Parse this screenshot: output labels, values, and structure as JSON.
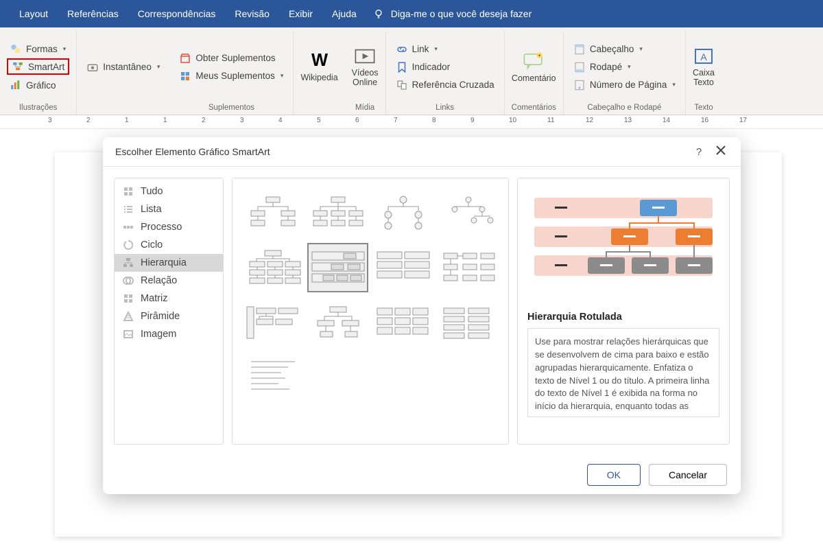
{
  "tabs": {
    "layout": "Layout",
    "references": "Referências",
    "mailings": "Correspondências",
    "review": "Revisão",
    "view": "Exibir",
    "help": "Ajuda",
    "tellme": "Diga-me o que você deseja fazer"
  },
  "ribbon": {
    "ilustracoes": {
      "label": "Ilustrações",
      "formas": "Formas",
      "smartart": "SmartArt",
      "grafico": "Gráfico"
    },
    "instantaneo": "Instantâneo",
    "suplementos": {
      "label": "Suplementos",
      "obter": "Obter Suplementos",
      "meus": "Meus Suplementos"
    },
    "wikipedia": "Wikipedia",
    "midia": {
      "label": "Mídia",
      "videos": "Vídeos\nOnline"
    },
    "links": {
      "label": "Links",
      "link": "Link",
      "indicador": "Indicador",
      "ref": "Referência Cruzada"
    },
    "comentarios": {
      "label": "Comentários",
      "comentario": "Comentário"
    },
    "cabecalho": {
      "label": "Cabeçalho e Rodapé",
      "cab": "Cabeçalho",
      "rod": "Rodapé",
      "num": "Número de Página"
    },
    "texto": {
      "label": "Texto",
      "caixa": "Caixa\nTexto"
    }
  },
  "dialog": {
    "title": "Escolher Elemento Gráfico SmartArt",
    "help": "?",
    "categories": [
      {
        "key": "tudo",
        "label": "Tudo"
      },
      {
        "key": "lista",
        "label": "Lista"
      },
      {
        "key": "processo",
        "label": "Processo"
      },
      {
        "key": "ciclo",
        "label": "Ciclo"
      },
      {
        "key": "hierarquia",
        "label": "Hierarquia"
      },
      {
        "key": "relacao",
        "label": "Relação"
      },
      {
        "key": "matriz",
        "label": "Matriz"
      },
      {
        "key": "piramide",
        "label": "Pirâmide"
      },
      {
        "key": "imagem",
        "label": "Imagem"
      }
    ],
    "selected_category": "hierarquia",
    "selected_thumb": 5,
    "preview_title": "Hierarquia Rotulada",
    "preview_desc": "Use para mostrar relações hierárquicas que se desenvolvem de cima para baixo e estão agrupadas hierarquicamente. Enfatiza o texto de Nível 1 ou do título. A primeira linha do texto de Nível 1 é exibida na forma no início da hierarquia, enquanto todas as",
    "ok": "OK",
    "cancel": "Cancelar"
  },
  "ruler_marks": [
    "3",
    "2",
    "1",
    "1",
    "2",
    "3",
    "4",
    "5",
    "6",
    "7",
    "8",
    "9",
    "10",
    "11",
    "12",
    "13",
    "14",
    "16",
    "17"
  ]
}
